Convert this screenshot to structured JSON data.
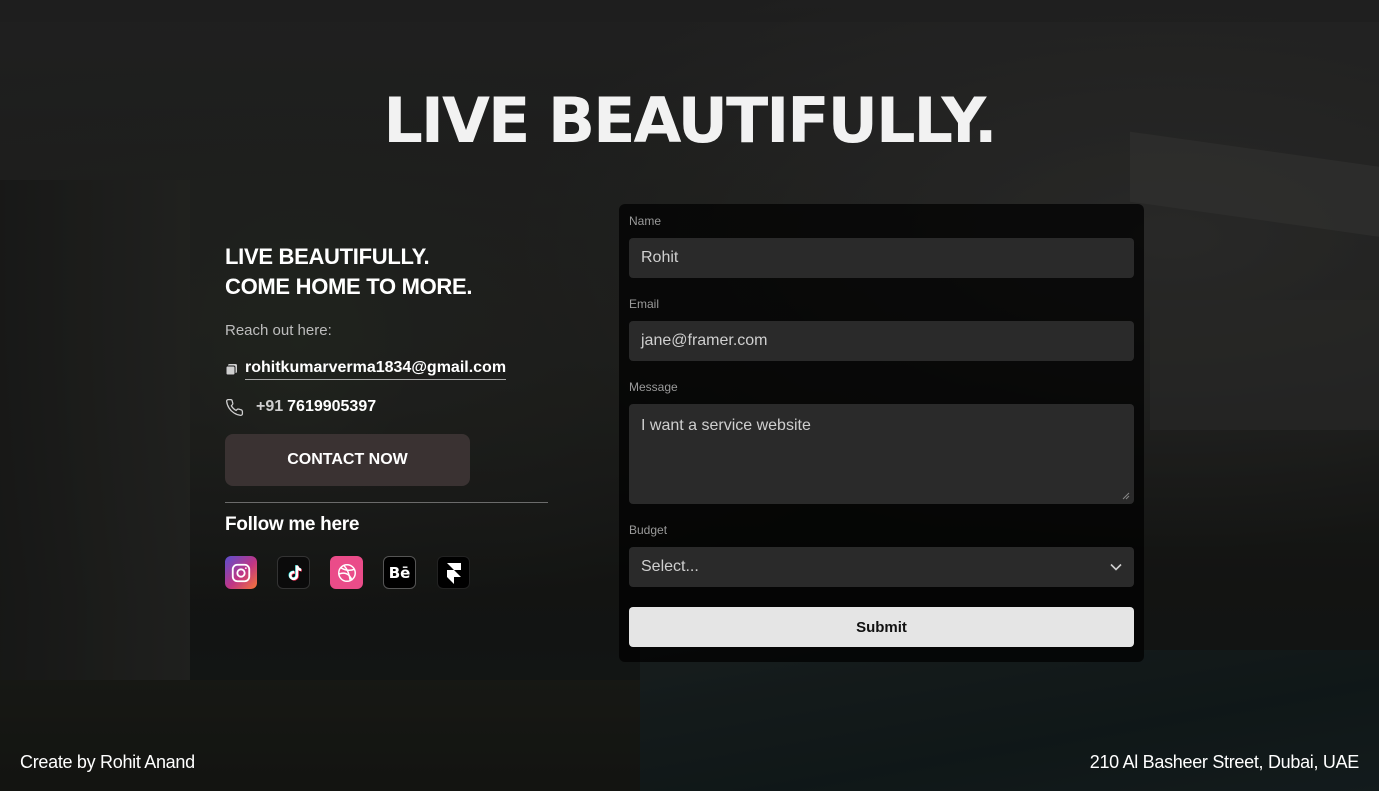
{
  "hero": {
    "headline": "LIVE BEAUTIFULLY."
  },
  "info": {
    "tagline_line1": "LIVE BEAUTIFULLY.",
    "tagline_line2": "COME HOME TO MORE.",
    "reach_label": "Reach out here:",
    "email": "rohitkumarverma1834@gmail.com",
    "phone_prefix": "+91",
    "phone_number": "7619905397",
    "contact_button": "CONTACT NOW",
    "follow_heading": "Follow me here",
    "socials": [
      "instagram-icon",
      "tiktok-icon",
      "dribbble-icon",
      "behance-icon",
      "framer-icon"
    ],
    "behance_glyph": "Bē"
  },
  "form": {
    "name_label": "Name",
    "name_value": "Rohit",
    "email_label": "Email",
    "email_value": "jane@framer.com",
    "message_label": "Message",
    "message_value": "I want a service website",
    "budget_label": "Budget",
    "budget_value": "Select...",
    "submit_label": "Submit"
  },
  "footer": {
    "credit": "Create by Rohit Anand",
    "address": "210 Al Basheer Street, Dubai, UAE"
  },
  "colors": {
    "contact_button_bg": "#3a3232",
    "submit_bg": "#e5e5e5",
    "field_bg": "#2a2a2a",
    "dribbble": "#ea4c89"
  }
}
